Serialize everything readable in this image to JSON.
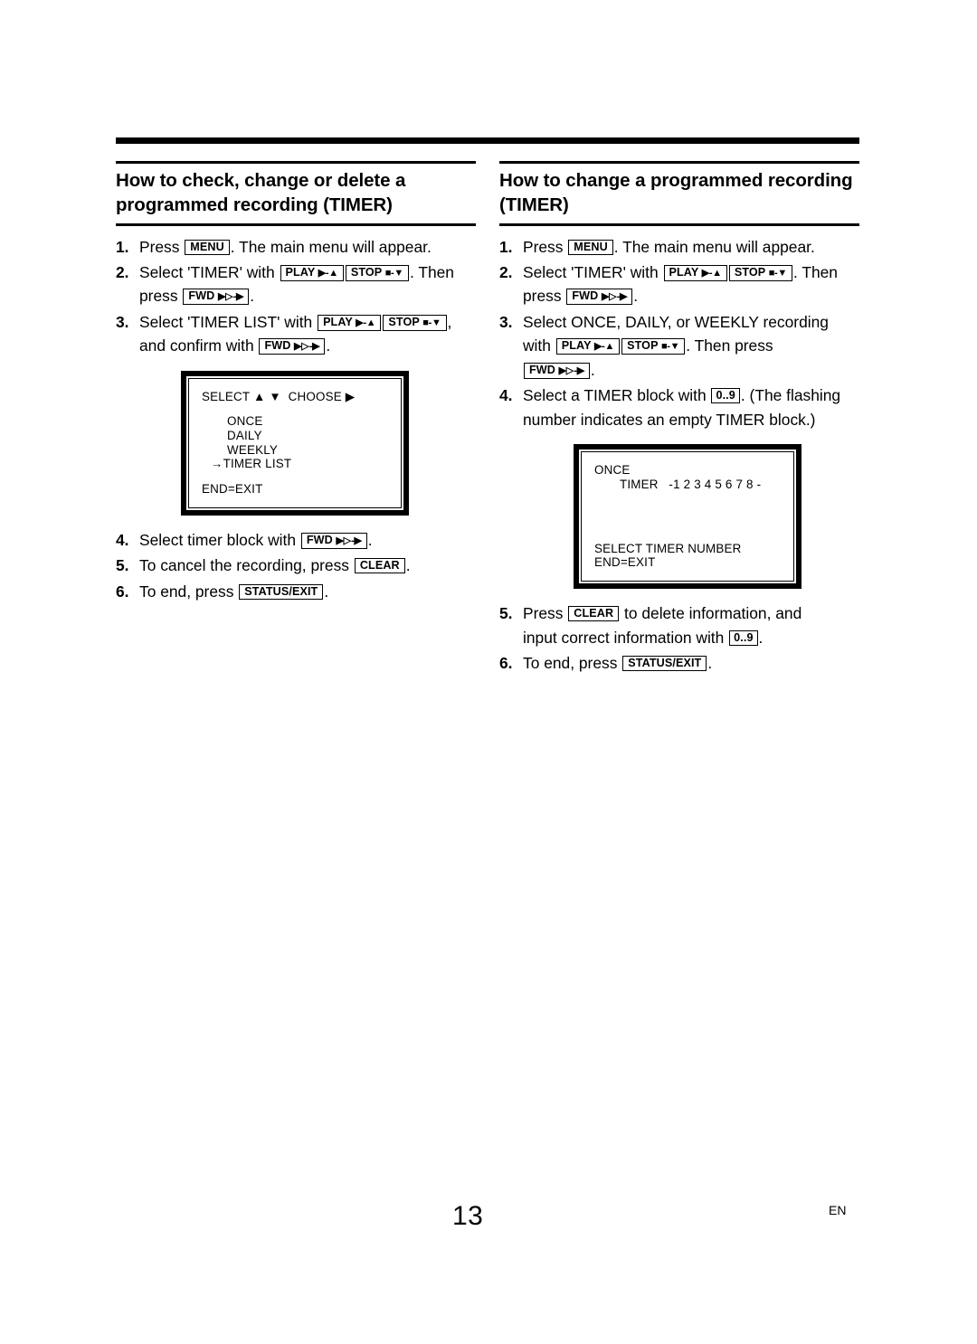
{
  "page": {
    "folio": "13",
    "language_code": "EN"
  },
  "keys": {
    "menu": "MENU",
    "play": "PLAY",
    "play_glyph": "▶-▲",
    "stop": "STOP",
    "stop_glyph": "■-▼",
    "fwd": "FWD",
    "fwd_glyph_solid": "▶",
    "fwd_glyph_open": "▷",
    "fwd_glyph_tail": "-▶",
    "clear": "CLEAR",
    "status_exit": "STATUS/EXIT",
    "numeric": "0..9"
  },
  "columns": [
    {
      "heading": "How to check, change or delete a programmed recording (TIMER)",
      "steps": [
        {
          "number": "1.",
          "lines": [
            [
              {
                "t": "text",
                "v": "Press "
              },
              {
                "t": "key",
                "v": "menu"
              },
              {
                "t": "text",
                "v": ". The main menu will appear."
              }
            ]
          ]
        },
        {
          "number": "2.",
          "lines": [
            [
              {
                "t": "text",
                "v": "Select 'TIMER' with "
              },
              {
                "t": "key",
                "v": "play"
              },
              {
                "t": "key",
                "v": "stop"
              },
              {
                "t": "text",
                "v": ". Then"
              }
            ],
            [
              {
                "t": "text",
                "v": "press "
              },
              {
                "t": "key",
                "v": "fwd"
              },
              {
                "t": "text",
                "v": "."
              }
            ]
          ]
        },
        {
          "number": "3.",
          "lines": [
            [
              {
                "t": "text",
                "v": "Select 'TIMER LIST' with "
              },
              {
                "t": "key",
                "v": "play"
              },
              {
                "t": "key",
                "v": "stop"
              },
              {
                "t": "text",
                "v": ","
              }
            ],
            [
              {
                "t": "text",
                "v": "and confirm with "
              },
              {
                "t": "key",
                "v": "fwd"
              },
              {
                "t": "text",
                "v": "."
              }
            ]
          ]
        }
      ],
      "osd": {
        "header": "SELECT ▲ ▼  CHOOSE ▶",
        "items": [
          "ONCE",
          "DAILY",
          "WEEKLY"
        ],
        "selected_item": "→TIMER LIST",
        "footer": "END=EXIT"
      },
      "steps_after": [
        {
          "number": "4.",
          "lines": [
            [
              {
                "t": "text",
                "v": "Select timer block with "
              },
              {
                "t": "key",
                "v": "fwd"
              },
              {
                "t": "text",
                "v": "."
              }
            ]
          ]
        },
        {
          "number": "5.",
          "lines": [
            [
              {
                "t": "text",
                "v": "To cancel the recording, press "
              },
              {
                "t": "key",
                "v": "clear"
              },
              {
                "t": "text",
                "v": "."
              }
            ]
          ]
        },
        {
          "number": "6.",
          "lines": [
            [
              {
                "t": "text",
                "v": "To end, press "
              },
              {
                "t": "key",
                "v": "status_exit"
              },
              {
                "t": "text",
                "v": "."
              }
            ]
          ]
        }
      ]
    },
    {
      "heading": "How to change a programmed recording (TIMER)",
      "steps": [
        {
          "number": "1.",
          "lines": [
            [
              {
                "t": "text",
                "v": "Press "
              },
              {
                "t": "key",
                "v": "menu"
              },
              {
                "t": "text",
                "v": ". The main menu will appear."
              }
            ]
          ]
        },
        {
          "number": "2.",
          "lines": [
            [
              {
                "t": "text",
                "v": "Select 'TIMER' with "
              },
              {
                "t": "key",
                "v": "play"
              },
              {
                "t": "key",
                "v": "stop"
              },
              {
                "t": "text",
                "v": ". Then"
              }
            ],
            [
              {
                "t": "text",
                "v": "press "
              },
              {
                "t": "key",
                "v": "fwd"
              },
              {
                "t": "text",
                "v": "."
              }
            ]
          ]
        },
        {
          "number": "3.",
          "lines": [
            [
              {
                "t": "text",
                "v": "Select ONCE, DAILY, or WEEKLY recording"
              }
            ],
            [
              {
                "t": "text",
                "v": "with "
              },
              {
                "t": "key",
                "v": "play"
              },
              {
                "t": "key",
                "v": "stop"
              },
              {
                "t": "text",
                "v": ". Then press"
              }
            ],
            [
              {
                "t": "key",
                "v": "fwd"
              },
              {
                "t": "text",
                "v": "."
              }
            ]
          ]
        },
        {
          "number": "4.",
          "lines": [
            [
              {
                "t": "text",
                "v": "Select a TIMER block with "
              },
              {
                "t": "key",
                "v": "numeric"
              },
              {
                "t": "text",
                "v": ". (The flashing"
              }
            ],
            [
              {
                "t": "text",
                "v": "number indicates an empty TIMER block.)"
              }
            ]
          ]
        }
      ],
      "osd": {
        "mode": "ONCE",
        "timer_label": "TIMER",
        "timer_numbers": "-1 2 3 4 5 6 7 8 -",
        "footer_line1": "SELECT TIMER NUMBER",
        "footer_line2": "END=EXIT"
      },
      "steps_after": [
        {
          "number": "5.",
          "lines": [
            [
              {
                "t": "text",
                "v": "Press "
              },
              {
                "t": "key",
                "v": "clear"
              },
              {
                "t": "text",
                "v": " to delete information, and"
              }
            ],
            [
              {
                "t": "text",
                "v": "input correct information with "
              },
              {
                "t": "key",
                "v": "numeric"
              },
              {
                "t": "text",
                "v": "."
              }
            ]
          ]
        },
        {
          "number": "6.",
          "lines": [
            [
              {
                "t": "text",
                "v": "To end, press "
              },
              {
                "t": "key",
                "v": "status_exit"
              },
              {
                "t": "text",
                "v": "."
              }
            ]
          ]
        }
      ]
    }
  ]
}
